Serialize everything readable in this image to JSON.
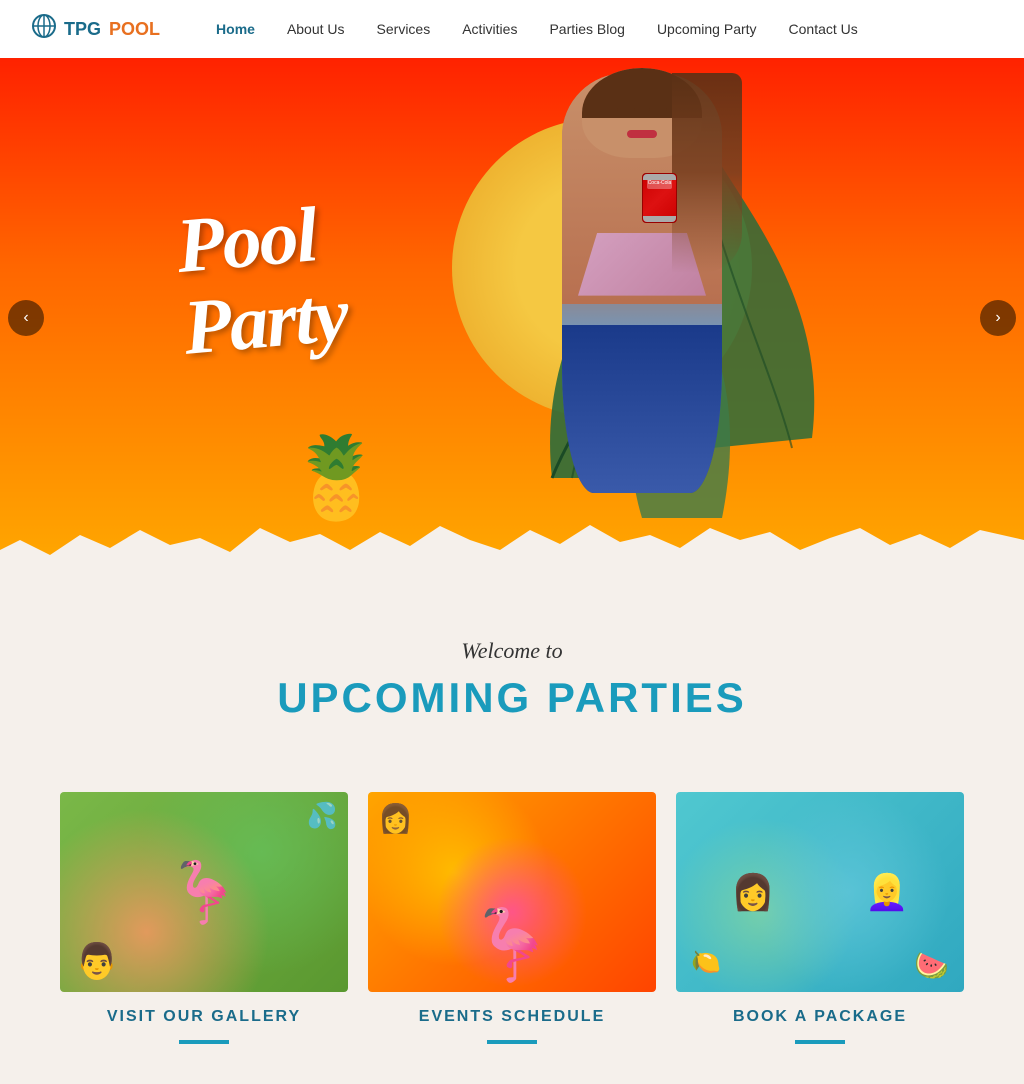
{
  "header": {
    "logo_tpg": "TPG",
    "logo_pool": "POOL",
    "logo_icon": "🏊",
    "nav": [
      {
        "label": "Home",
        "active": true
      },
      {
        "label": "About Us",
        "active": false
      },
      {
        "label": "Services",
        "active": false
      },
      {
        "label": "Activities",
        "active": false
      },
      {
        "label": "Parties Blog",
        "active": false
      },
      {
        "label": "Upcoming Party",
        "active": false
      },
      {
        "label": "Contact Us",
        "active": false
      }
    ]
  },
  "hero": {
    "line1": "Pool",
    "line2": "Party",
    "arrow_left": "‹",
    "arrow_right": "›"
  },
  "welcome": {
    "subtitle": "Welcome to",
    "title": "UPCOMING PARTIES"
  },
  "cards": [
    {
      "title": "VISIT OUR GALLERY",
      "img_class": "card-photo-1"
    },
    {
      "title": "EVENTS SCHEDULE",
      "img_class": "card-photo-2"
    },
    {
      "title": "BOOK A PACKAGE",
      "img_class": "card-photo-3"
    }
  ]
}
